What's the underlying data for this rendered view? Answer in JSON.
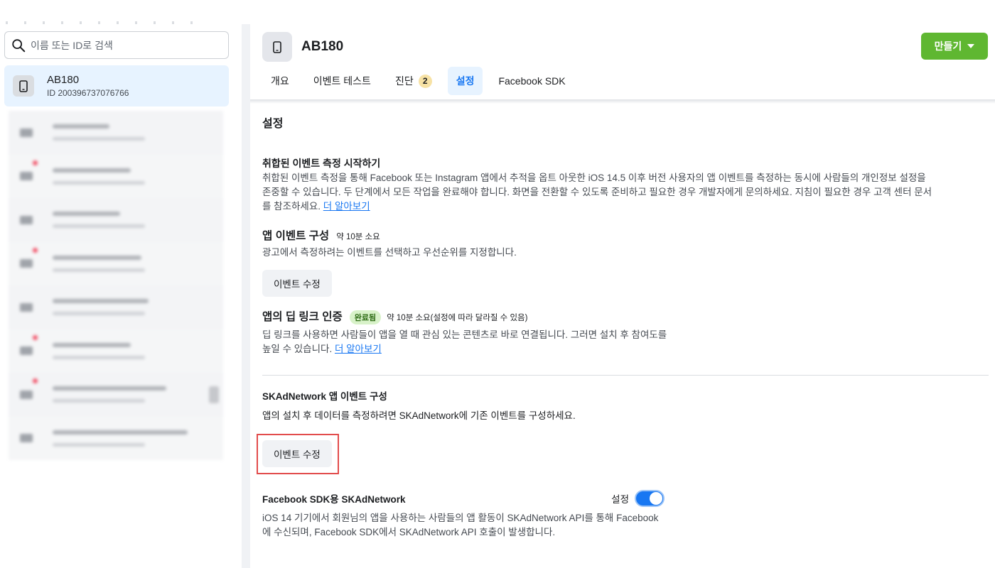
{
  "sidebar": {
    "search_placeholder": "이름 또는 ID로 검색",
    "selected": {
      "name": "AB180",
      "id_text": "ID 200396737076766"
    },
    "blurred_items": [
      {
        "has_dot": false,
        "has_action": false,
        "w1": 80,
        "w2": 130
      },
      {
        "has_dot": true,
        "has_action": false,
        "w1": 110,
        "w2": 130
      },
      {
        "has_dot": false,
        "has_action": false,
        "w1": 95,
        "w2": 130
      },
      {
        "has_dot": true,
        "has_action": false,
        "w1": 125,
        "w2": 130
      },
      {
        "has_dot": false,
        "has_action": false,
        "w1": 135,
        "w2": 130
      },
      {
        "has_dot": true,
        "has_action": false,
        "w1": 110,
        "w2": 130
      },
      {
        "has_dot": true,
        "has_action": true,
        "w1": 160,
        "w2": 130
      },
      {
        "has_dot": false,
        "has_action": false,
        "w1": 190,
        "w2": 130
      }
    ]
  },
  "header": {
    "title": "AB180",
    "create_label": "만들기"
  },
  "tabs": [
    {
      "label": "개요",
      "active": false
    },
    {
      "label": "이벤트 테스트",
      "active": false
    },
    {
      "label": "진단",
      "active": false,
      "badge": "2"
    },
    {
      "label": "설정",
      "active": true
    },
    {
      "label": "Facebook SDK",
      "active": false
    }
  ],
  "content": {
    "section_title": "설정",
    "aem": {
      "title": "취합된 이벤트 측정 시작하기",
      "desc_1": "취합된 이벤트 측정을 통해 Facebook 또는 Instagram 앱에서 추적을 옵트 아웃한 iOS 14.5 이후 버전 사용자의 앱 이벤트를 측정하는 동시에 사람들의 개인정보 설정을",
      "desc_2": "존중할 수 있습니다. 두 단계에서 모든 작업을 완료해야 합니다. 화면을 전환할 수 있도록 준비하고 필요한 경우 개발자에게 문의하세요. 지침이 필요한 경우 고객 센터 문서",
      "desc_3": "를 참조하세요.",
      "learn_more": "더 알아보기"
    },
    "app_events": {
      "title": "앱 이벤트 구성",
      "time_note": "약 10분 소요",
      "desc": "광고에서 측정하려는 이벤트를 선택하고 우선순위를 지정합니다.",
      "button": "이벤트 수정"
    },
    "deep_link": {
      "title": "앱의 딥 링크 인증",
      "status": "완료됨",
      "time_note": "약 10분 소요(설정에 따라 달라질 수 있음)",
      "desc_1": "딥 링크를 사용하면 사람들이 앱을 열 때 관심 있는 콘텐츠로 바로 연결됩니다. 그러면 설치 후 참여도를",
      "desc_2": "높일 수 있습니다.",
      "learn_more": "더 알아보기"
    },
    "skan": {
      "title": "SKAdNetwork 앱 이벤트 구성",
      "desc": "앱의 설치 후 데이터를 측정하려면 SKAdNetwork에 기존 이벤트를 구성하세요.",
      "button": "이벤트 수정"
    },
    "sdk_skan": {
      "title": "Facebook SDK용 SKAdNetwork",
      "toggle_label": "설정",
      "toggle_on": true,
      "desc_1": "iOS 14 기기에서 회원님의 앱을 사용하는 사람들의 앱 활동이 SKAdNetwork API를 통해 Facebook",
      "desc_2": "에 수신되며, Facebook SDK에서 SKAdNetwork API 호출이 발생합니다."
    }
  },
  "colors": {
    "accent": "#1877f2",
    "create_button": "#5fb731",
    "highlight_border": "#e24c4c"
  }
}
